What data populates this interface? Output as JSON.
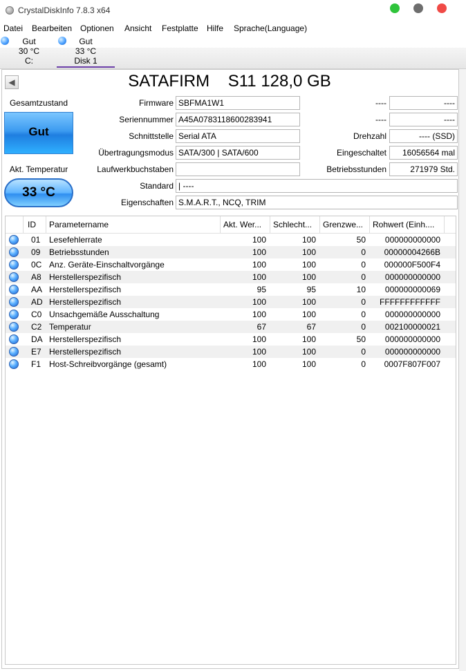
{
  "window": {
    "title": "CrystalDiskInfo 7.8.3 x64"
  },
  "menu": [
    "Datei",
    "Bearbeiten",
    "Optionen",
    "Ansicht",
    "Festplatte",
    "Hilfe",
    "Sprache(Language)"
  ],
  "disks": [
    {
      "status": "Gut",
      "temp": "30 °C",
      "name": "C:"
    },
    {
      "status": "Gut",
      "temp": "33 °C",
      "name": "Disk 1"
    }
  ],
  "model": "SATAFIRM    S11 128,0 GB",
  "left": {
    "health_label": "Gesamtzustand",
    "health_value": "Gut",
    "temp_label": "Akt. Temperatur",
    "temp_value": "33 °C"
  },
  "info": {
    "firmware_label": "Firmware",
    "firmware": "SBFMA1W1",
    "serial_label": "Seriennummer",
    "serial": "A45A0783118600283941",
    "interface_label": "Schnittstelle",
    "interface": "Serial ATA",
    "transfer_label": "Übertragungsmodus",
    "transfer": "SATA/300 | SATA/600",
    "drive_letter_label": "Laufwerkbuchstaben",
    "drive_letter": "",
    "standard_label": "Standard",
    "standard": "| ----",
    "features_label": "Eigenschaften",
    "features": "S.M.A.R.T., NCQ, TRIM",
    "r1_label": "----",
    "r1_value": "----",
    "r2_label": "----",
    "r2_value": "----",
    "rpm_label": "Drehzahl",
    "rpm": "---- (SSD)",
    "power_count_label": "Eingeschaltet",
    "power_count": "16056564 mal",
    "power_hours_label": "Betriebsstunden",
    "power_hours": "271979 Std."
  },
  "table": {
    "headers": [
      "ID",
      "Parametername",
      "Akt. Wer...",
      "Schlecht...",
      "Grenzwe...",
      "Rohwert (Einh...."
    ],
    "rows": [
      [
        "01",
        "Lesefehlerrate",
        "100",
        "100",
        "50",
        "000000000000"
      ],
      [
        "09",
        "Betriebsstunden",
        "100",
        "100",
        "0",
        "00000004266B"
      ],
      [
        "0C",
        "Anz. Geräte-Einschaltvorgänge",
        "100",
        "100",
        "0",
        "000000F500F4"
      ],
      [
        "A8",
        "Herstellerspezifisch",
        "100",
        "100",
        "0",
        "000000000000"
      ],
      [
        "AA",
        "Herstellerspezifisch",
        "95",
        "95",
        "10",
        "000000000069"
      ],
      [
        "AD",
        "Herstellerspezifisch",
        "100",
        "100",
        "0",
        "FFFFFFFFFFFF"
      ],
      [
        "C0",
        "Unsachgemäße Ausschaltung",
        "100",
        "100",
        "0",
        "000000000000"
      ],
      [
        "C2",
        "Temperatur",
        "67",
        "67",
        "0",
        "002100000021"
      ],
      [
        "DA",
        "Herstellerspezifisch",
        "100",
        "100",
        "50",
        "000000000000"
      ],
      [
        "E7",
        "Herstellerspezifisch",
        "100",
        "100",
        "0",
        "000000000000"
      ],
      [
        "F1",
        "Host-Schreibvorgänge (gesamt)",
        "100",
        "100",
        "0",
        "0007F807F007"
      ]
    ]
  },
  "colors": {
    "health": "#3c9bf0",
    "temp": "#5fb4ff",
    "active_tab": "#6b3fa8"
  }
}
